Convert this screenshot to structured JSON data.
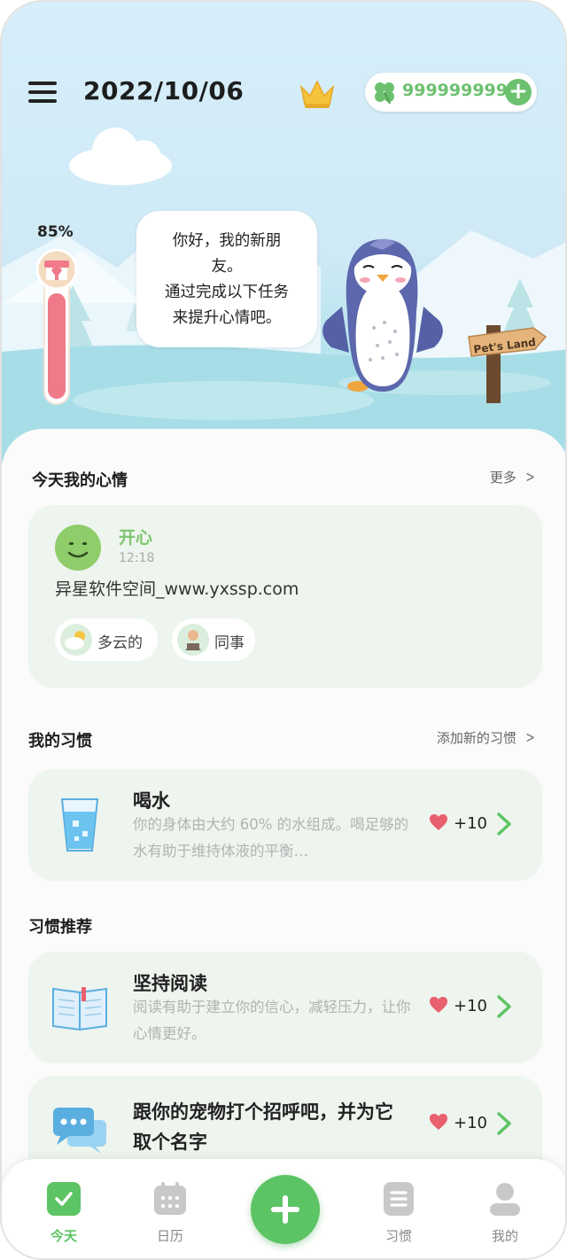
{
  "header": {
    "date": "2022/10/06",
    "coins": "999999999",
    "icons": {
      "menu": "hamburger-menu-icon",
      "crown": "crown-icon",
      "clover": "clover-icon",
      "add": "plus-icon"
    }
  },
  "pet": {
    "mood_percent": "85%",
    "mood_level": 0.85,
    "speech": "你好，我的新朋\n友。\n通过完成以下任务\n来提升心情吧。",
    "sign_text": "Pet's Land"
  },
  "mood_section": {
    "title": "今天我的心情",
    "more": "更多",
    "entry": {
      "mood": "开心",
      "time": "12:18",
      "note": "异星软件空间_www.yxssp.com",
      "tags": [
        {
          "label": "多云的",
          "icon": "cloudy-weather-icon"
        },
        {
          "label": "同事",
          "icon": "coworker-avatar-icon"
        }
      ]
    }
  },
  "habits_section": {
    "title": "我的习惯",
    "add": "添加新的习惯",
    "items": [
      {
        "name": "喝水",
        "desc": "你的身体由大约 60% 的水组成。喝足够的水有助于维持体液的平衡…",
        "reward": "+10",
        "icon": "water-glass-icon"
      }
    ]
  },
  "recommend_section": {
    "title": "习惯推荐",
    "items": [
      {
        "name": "坚持阅读",
        "desc": "阅读有助于建立你的信心，减轻压力，让你心情更好。",
        "reward": "+10",
        "icon": "open-book-icon"
      },
      {
        "name": "跟你的宠物打个招呼吧，并为它取个名字",
        "desc": "",
        "reward": "+10",
        "icon": "chat-bubbles-icon"
      }
    ]
  },
  "tabbar": {
    "tabs": [
      {
        "label": "今天",
        "icon": "check-square-icon",
        "active": true
      },
      {
        "label": "日历",
        "icon": "calendar-icon",
        "active": false
      },
      {
        "label": "习惯",
        "icon": "list-icon",
        "active": false
      },
      {
        "label": "我的",
        "icon": "profile-icon",
        "active": false
      }
    ],
    "fab_icon": "plus-icon"
  },
  "colors": {
    "accent": "#5cc464",
    "mood_text": "#7cc66d",
    "heart": "#e8606e",
    "card_bg": "#eef4ee"
  }
}
